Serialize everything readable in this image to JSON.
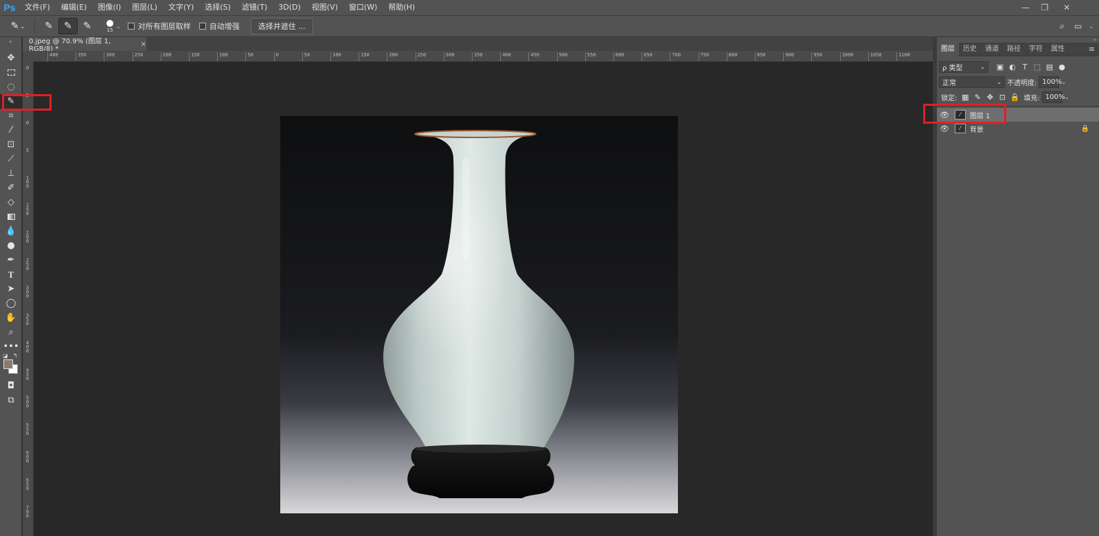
{
  "app": {
    "logo": "Ps"
  },
  "menu": [
    "文件(F)",
    "编辑(E)",
    "图像(I)",
    "图层(L)",
    "文字(Y)",
    "选择(S)",
    "滤镜(T)",
    "3D(D)",
    "视图(V)",
    "窗口(W)",
    "帮助(H)"
  ],
  "window_controls": {
    "minimize": "—",
    "restore": "❐",
    "close": "✕"
  },
  "options": {
    "brush_size": "15",
    "sample_all_layers": "对所有图层取样",
    "auto_enhance": "自动增强",
    "select_and_mask": "选择并遮住 ..."
  },
  "document": {
    "tab_title": "0.jpeg @ 70.9% (图层 1, RGB/8) *",
    "close": "×"
  },
  "ruler": {
    "h_labels": [
      "400",
      "350",
      "300",
      "250",
      "200",
      "150",
      "100",
      "50",
      "0",
      "50",
      "100",
      "150",
      "200",
      "250",
      "300",
      "350",
      "400",
      "450",
      "500",
      "550",
      "600",
      "650",
      "700",
      "750",
      "800",
      "850",
      "900",
      "950",
      "1000",
      "1050",
      "1100"
    ],
    "v_labels": [
      "0",
      "5",
      "0",
      "5",
      "1 0 0",
      "1 5 0",
      "2 0 0",
      "2 5 0",
      "3 0 0",
      "3 5 0",
      "4 0 0",
      "4 5 0",
      "5 0 0",
      "5 5 0",
      "6 0 0",
      "6 5 0",
      "7 0 0"
    ]
  },
  "panels": {
    "tabs": [
      "图层",
      "历史",
      "通道",
      "路径",
      "字符",
      "属性"
    ],
    "filter_kind": "ρ 类型",
    "blend_mode": "正常",
    "opacity_label": "不透明度:",
    "opacity_value": "100%",
    "lock_label": "锁定:",
    "fill_label": "填充:",
    "fill_value": "100%",
    "layers": [
      {
        "name": "图层 1",
        "selected": true,
        "locked": false
      },
      {
        "name": "背景",
        "selected": false,
        "locked": true
      }
    ]
  },
  "colors": {
    "foreground": "#8c7a6f",
    "background": "#ffffff",
    "highlight": "#e21f26",
    "ps_blue": "#31a8ff"
  },
  "icons": {
    "tools": [
      "move-icon",
      "marquee-icon",
      "lasso-icon",
      "quick-selection-icon",
      "crop-icon",
      "eyedropper-icon",
      "spot-healing-icon",
      "brush-icon",
      "stamp-icon",
      "history-brush-icon",
      "eraser-icon",
      "gradient-icon",
      "blur-icon",
      "dodge-icon",
      "pen-icon",
      "type-icon",
      "path-selection-icon",
      "ellipse-icon",
      "hand-icon",
      "zoom-icon",
      "more-icon"
    ]
  }
}
